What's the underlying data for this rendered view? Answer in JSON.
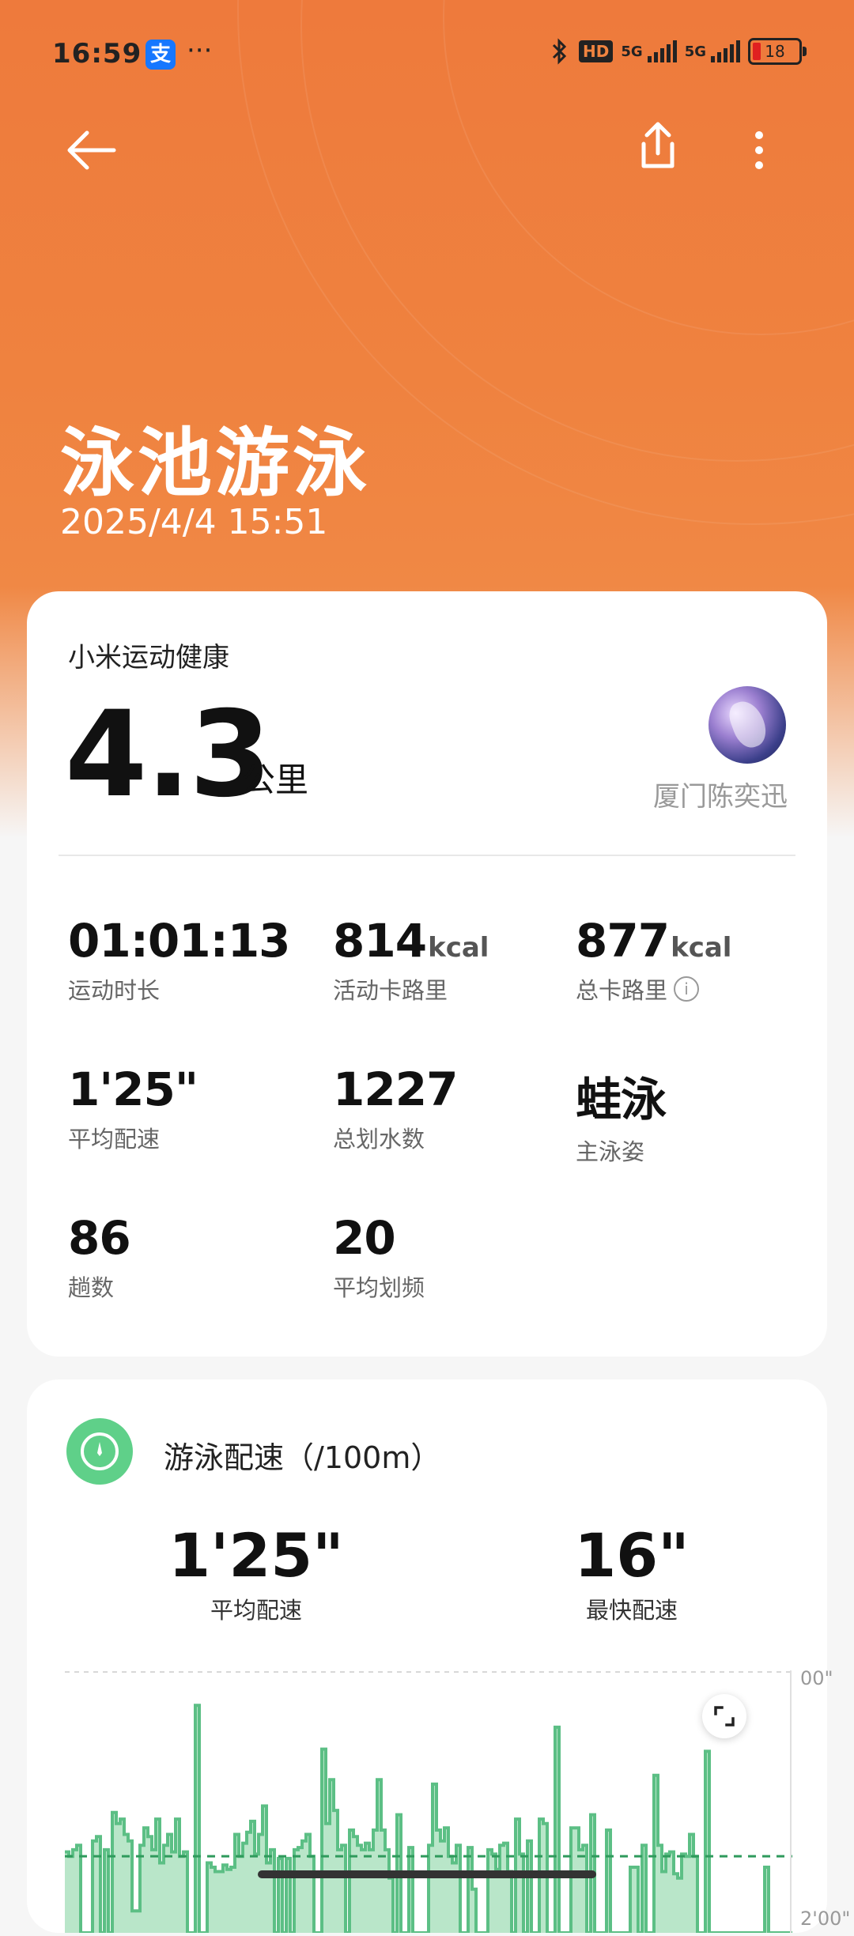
{
  "status_bar": {
    "time": "16:59",
    "alipay_glyph": "支",
    "more": "···",
    "hd_label": "HD",
    "network_1": "5G",
    "network_2": "5G",
    "battery": "18"
  },
  "nav": {
    "back_icon": "arrow-left-icon",
    "share_icon": "share-icon",
    "more_icon": "more-vertical-icon"
  },
  "header": {
    "title": "泳池游泳",
    "datetime": "2025/4/4 15:51"
  },
  "summary": {
    "source": "小米运动健康",
    "distance": "4.3",
    "distance_unit": "公里",
    "user_name": "厦门陈奕迅",
    "stats": [
      {
        "value": "01:01:13",
        "unit": "",
        "label": "运动时长"
      },
      {
        "value": "814",
        "unit": "kcal",
        "label": "活动卡路里"
      },
      {
        "value": "877",
        "unit": "kcal",
        "label": "总卡路里",
        "info_icon": "info-icon"
      },
      {
        "value": "1'25\"",
        "unit": "",
        "label": "平均配速"
      },
      {
        "value": "1227",
        "unit": "",
        "label": "总划水数"
      },
      {
        "value": "蛙泳",
        "unit": "",
        "label": "主泳姿"
      },
      {
        "value": "86",
        "unit": "",
        "label": "趟数"
      },
      {
        "value": "20",
        "unit": "",
        "label": "平均划频"
      }
    ]
  },
  "pace_card": {
    "title": "游泳配速（/100m）",
    "avg_value": "1'25\"",
    "avg_label": "平均配速",
    "fast_value": "16\"",
    "fast_label": "最快配速",
    "y_top_label": "00\"",
    "y_bottom_label": "2'00\"",
    "expand_icon": "expand-icon"
  },
  "chart_data": {
    "type": "area",
    "title": "",
    "xlabel": "",
    "ylabel": "",
    "y_axis": "pace seconds per 100m, inverted (00\" at top, 2'00\" at bottom)",
    "ylim": [
      0,
      120
    ],
    "y_ticks": [
      "00\"",
      "2'00\""
    ],
    "average_line": 85,
    "color": "#5cbf85",
    "fill": "#b9e6c9",
    "values": [
      83,
      85,
      82,
      80,
      120,
      120,
      120,
      78,
      76,
      120,
      82,
      120,
      65,
      70,
      68,
      75,
      78,
      110,
      110,
      80,
      72,
      76,
      82,
      68,
      88,
      80,
      75,
      83,
      68,
      85,
      83,
      120,
      120,
      16,
      120,
      120,
      88,
      90,
      92,
      92,
      89,
      91,
      90,
      75,
      85,
      79,
      74,
      69,
      84,
      75,
      62,
      88,
      82,
      120,
      86,
      120,
      86,
      120,
      82,
      81,
      78,
      75,
      85,
      120,
      120,
      36,
      70,
      50,
      64,
      82,
      80,
      120,
      73,
      76,
      80,
      82,
      79,
      82,
      73,
      50,
      73,
      82,
      95,
      120,
      66,
      120,
      120,
      81,
      120,
      120,
      120,
      120,
      80,
      52,
      73,
      78,
      72,
      85,
      88,
      80,
      120,
      120,
      81,
      100,
      120,
      120,
      120,
      82,
      84,
      91,
      80,
      79,
      92,
      120,
      68,
      84,
      120,
      78,
      120,
      120,
      68,
      70,
      120,
      120,
      26,
      120,
      120,
      120,
      72,
      72,
      82,
      80,
      120,
      66,
      120,
      120,
      120,
      73,
      120,
      120,
      120,
      120,
      120,
      90,
      90,
      120,
      80,
      120,
      120,
      48,
      80,
      92,
      84,
      83,
      93,
      95,
      84,
      85,
      75,
      85,
      120,
      120,
      37,
      120,
      120,
      120,
      120,
      120,
      120,
      120,
      120,
      120,
      120,
      120,
      120,
      120,
      120,
      90,
      120,
      120,
      120,
      120,
      120,
      120
    ]
  },
  "colors": {
    "hero_orange": "#ee7a3c",
    "accent_green": "#5fd089",
    "card_bg": "#ffffff"
  }
}
